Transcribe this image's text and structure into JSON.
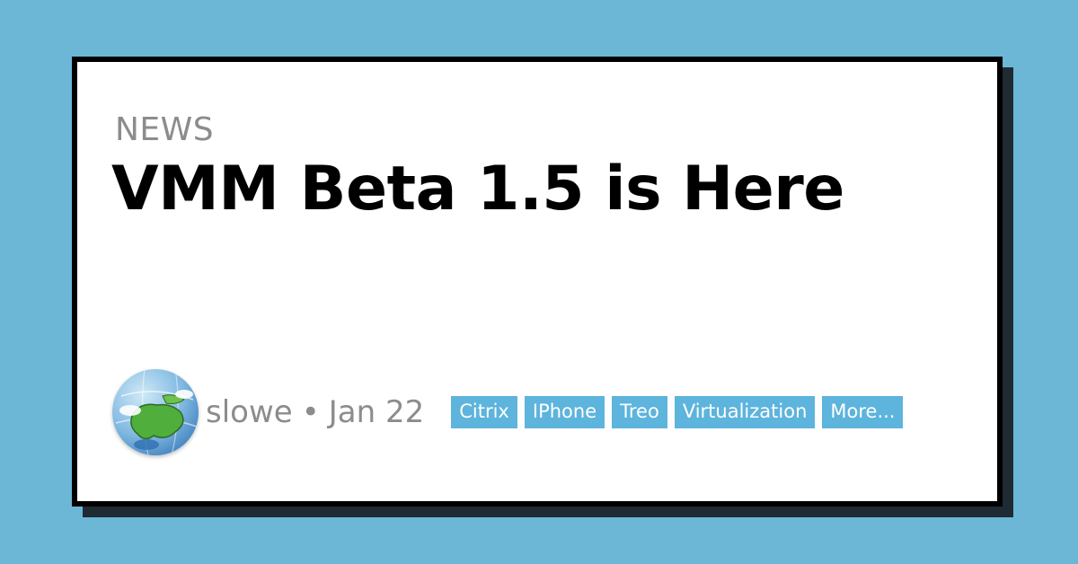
{
  "post": {
    "category": "NEWS",
    "title": "VMM Beta 1.5 is Here",
    "author": "slowe",
    "separator": "•",
    "date": "Jan 22"
  },
  "tags": [
    {
      "label": "Citrix"
    },
    {
      "label": "IPhone"
    },
    {
      "label": "Treo"
    },
    {
      "label": "Virtualization"
    },
    {
      "label": "More..."
    }
  ],
  "colors": {
    "background": "#6cb6d6",
    "card": "#ffffff",
    "border": "#000000",
    "tag": "#5db4dc",
    "muted_text": "#8c8c8c"
  },
  "icons": {
    "avatar": "globe-avatar-icon"
  }
}
